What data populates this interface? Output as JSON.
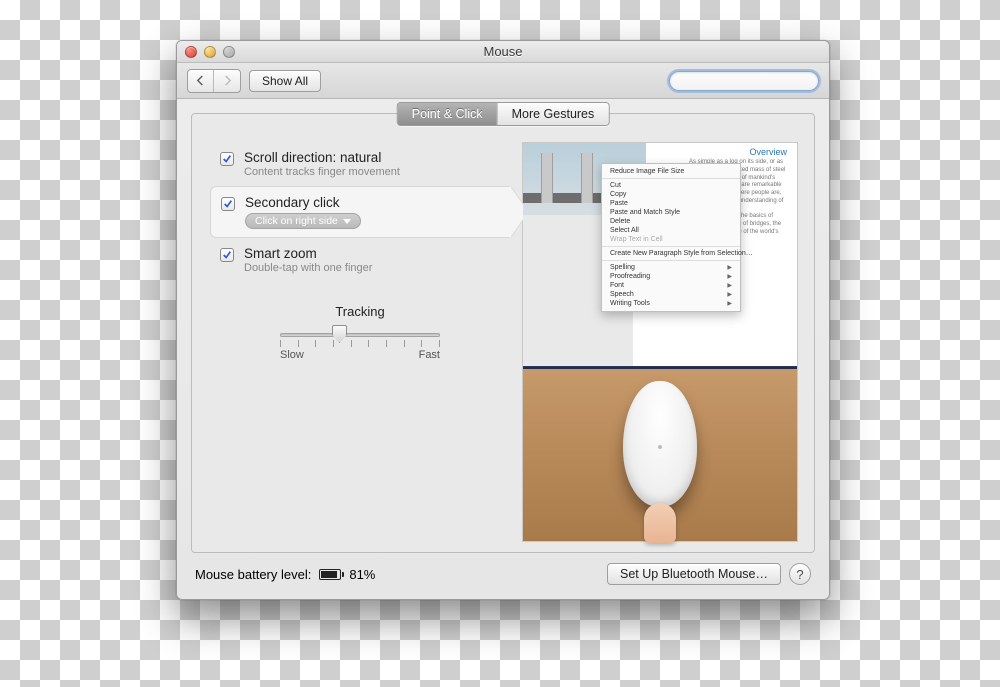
{
  "window": {
    "title": "Mouse"
  },
  "toolbar": {
    "show_all": "Show All",
    "search_placeholder": ""
  },
  "tabs": {
    "point_click": "Point & Click",
    "more_gestures": "More Gestures",
    "selected": "point_click"
  },
  "options": {
    "scroll": {
      "checked": true,
      "title": "Scroll direction: natural",
      "subtitle": "Content tracks finger movement"
    },
    "secondary": {
      "checked": true,
      "title": "Secondary click",
      "dropdown": "Click on right side"
    },
    "smartzoom": {
      "checked": true,
      "title": "Smart zoom",
      "subtitle": "Double-tap with one finger"
    }
  },
  "tracking": {
    "label": "Tracking",
    "slow": "Slow",
    "fast": "Fast",
    "value": 3,
    "max": 10
  },
  "preview": {
    "heading": "Overview",
    "context_menu": [
      "Reduce Image File Size",
      "-",
      "Cut",
      "Copy",
      "Paste",
      "Paste and Match Style",
      "Delete",
      "Select All",
      "~Wrap Text in Cell",
      "-",
      "Create New Paragraph Style from Selection…",
      "-",
      ">Spelling",
      ">Proofreading",
      ">Font",
      ">Speech",
      ">Writing Tools"
    ]
  },
  "footer": {
    "battery_label": "Mouse battery level:",
    "battery_value": "81%",
    "setup_button": "Set Up Bluetooth Mouse…",
    "help": "?"
  }
}
